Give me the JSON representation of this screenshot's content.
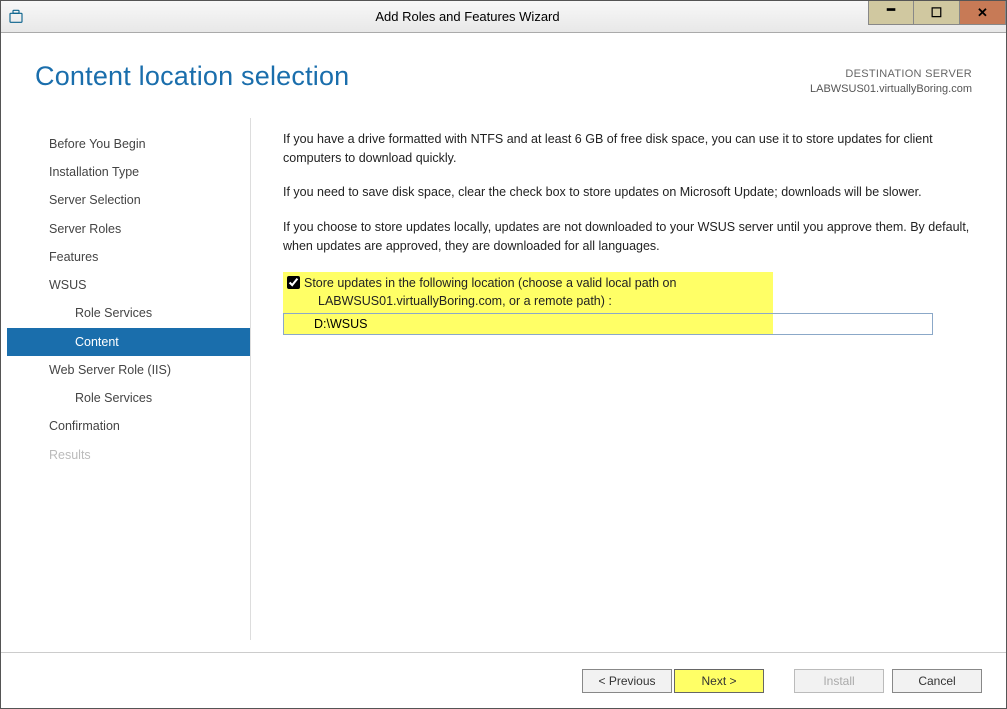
{
  "titlebar": {
    "title": "Add Roles and Features Wizard"
  },
  "header": {
    "page_title": "Content location selection",
    "dest_label": "DESTINATION SERVER",
    "dest_server": "LABWSUS01.virtuallyBoring.com"
  },
  "nav": {
    "before_you_begin": "Before You Begin",
    "installation_type": "Installation Type",
    "server_selection": "Server Selection",
    "server_roles": "Server Roles",
    "features": "Features",
    "wsus": "WSUS",
    "wsus_role_services": "Role Services",
    "wsus_content": "Content",
    "web_server_role": "Web Server Role (IIS)",
    "web_role_services": "Role Services",
    "confirmation": "Confirmation",
    "results": "Results"
  },
  "content": {
    "p1": "If you have a drive formatted with NTFS and at least 6 GB of free disk space, you can use it to store updates for client computers to download quickly.",
    "p2": "If you need to save disk space, clear the check box to store updates on Microsoft Update; downloads will be slower.",
    "p3": "If you choose to store updates locally, updates are not downloaded to your WSUS server until you approve them. By default, when updates are approved, they are downloaded for all languages.",
    "store_label_line1": "Store updates in the following location (choose a valid local path on",
    "store_label_line2": "LABWSUS01.virtuallyBoring.com, or a remote path) :",
    "store_checked": true,
    "path_value": "D:\\WSUS"
  },
  "footer": {
    "previous": "< Previous",
    "next": "Next >",
    "install": "Install",
    "cancel": "Cancel"
  }
}
